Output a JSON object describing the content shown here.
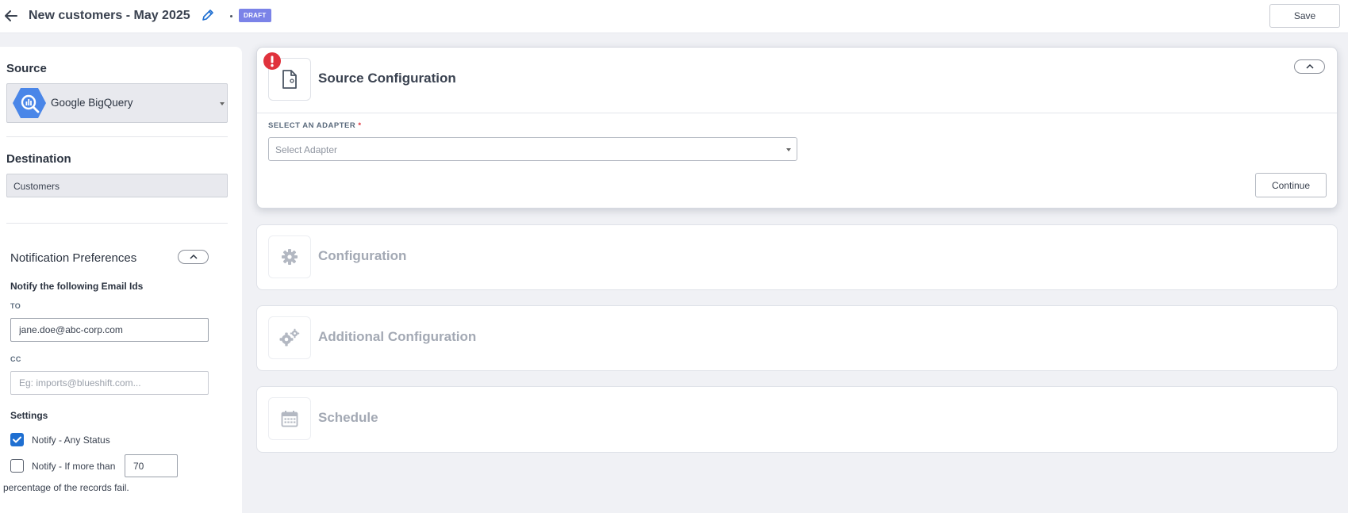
{
  "header": {
    "title": "New customers - May 2025",
    "status_badge": "DRAFT",
    "save_label": "Save"
  },
  "sidebar": {
    "source_label": "Source",
    "source_value": "Google BigQuery",
    "destination_label": "Destination",
    "destination_value": "Customers",
    "notification": {
      "title": "Notification Preferences",
      "notify_heading": "Notify the following Email Ids",
      "to_label": "TO",
      "to_value": "jane.doe@abc-corp.com",
      "cc_label": "CC",
      "cc_placeholder": "Eg: imports@blueshift.com...",
      "settings_label": "Settings",
      "any_status_label": "Notify - Any Status",
      "any_status_checked": true,
      "more_than_label": "Notify - If more than",
      "more_than_checked": false,
      "threshold_value": "70",
      "percentage_text": "percentage of the records fail."
    }
  },
  "steps": {
    "source_config": {
      "title": "Source Configuration",
      "adapter_label": "SELECT AN ADAPTER",
      "required_marker": "*",
      "adapter_placeholder": "Select Adapter",
      "continue_label": "Continue"
    },
    "configuration": {
      "title": "Configuration"
    },
    "additional": {
      "title": "Additional Configuration"
    },
    "schedule": {
      "title": "Schedule"
    }
  },
  "icons": {
    "back": "arrow-left-icon",
    "edit": "pencil-icon",
    "error": "exclamation-icon",
    "file": "file-icon",
    "gear": "gear-icon",
    "gears": "gears-icon",
    "calendar": "calendar-icon"
  },
  "colors": {
    "accent": "#1f6fd1",
    "badge": "#7b83e8",
    "error": "#e0323c",
    "bigquery": "#4a86e8"
  }
}
